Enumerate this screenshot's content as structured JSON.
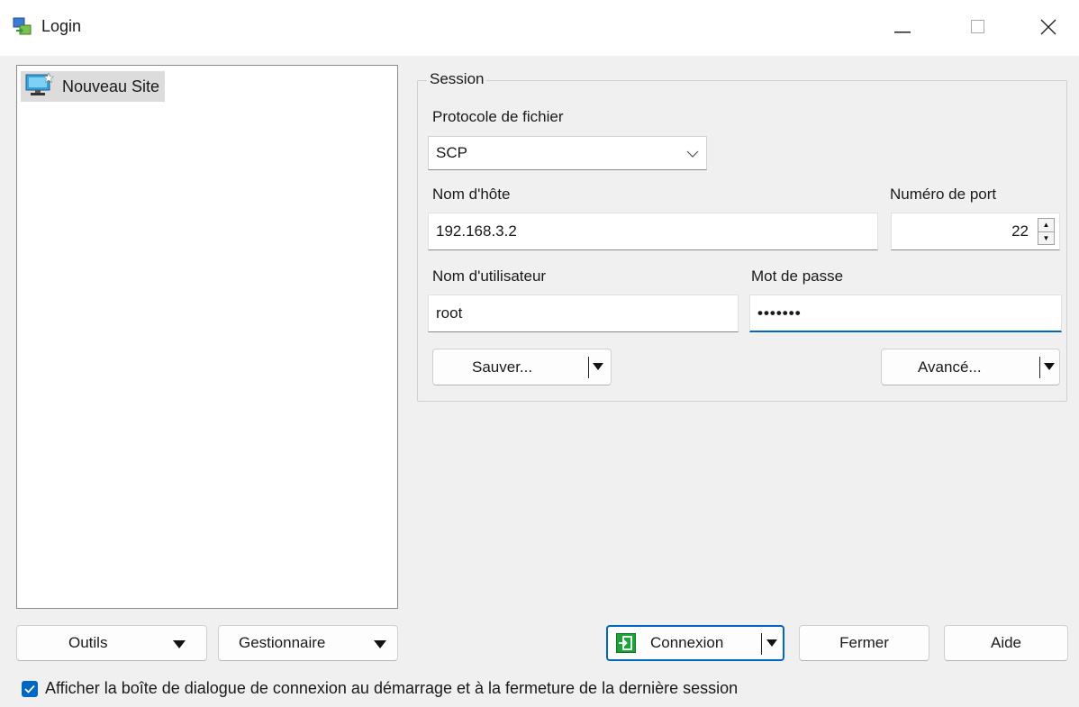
{
  "window": {
    "title": "Login",
    "controls": {
      "minimize": "—",
      "maximize": "☐",
      "close": "✕"
    }
  },
  "site_tree": {
    "items": [
      {
        "label": "Nouveau Site",
        "icon": "computer-new-site-icon",
        "selected": true
      }
    ]
  },
  "session": {
    "legend": "Session",
    "protocol_label": "Protocole de fichier",
    "protocol_value": "SCP",
    "host_label": "Nom d'hôte",
    "host_value": "192.168.3.2",
    "port_label": "Numéro de port",
    "port_value": "22",
    "user_label": "Nom d'utilisateur",
    "user_value": "root",
    "password_label": "Mot de passe",
    "password_value": "•••••••",
    "save_label": "Sauver...",
    "advanced_label": "Avancé..."
  },
  "footer": {
    "tools_label": "Outils",
    "manager_label": "Gestionnaire",
    "login_label": "Connexion",
    "close_label": "Fermer",
    "help_label": "Aide",
    "show_dialog_label": "Afficher la boîte de dialogue de connexion au démarrage et à la fermeture de la dernière session",
    "show_dialog_checked": true
  },
  "colors": {
    "accent": "#0067c0",
    "login_icon": "#1ea23a"
  }
}
